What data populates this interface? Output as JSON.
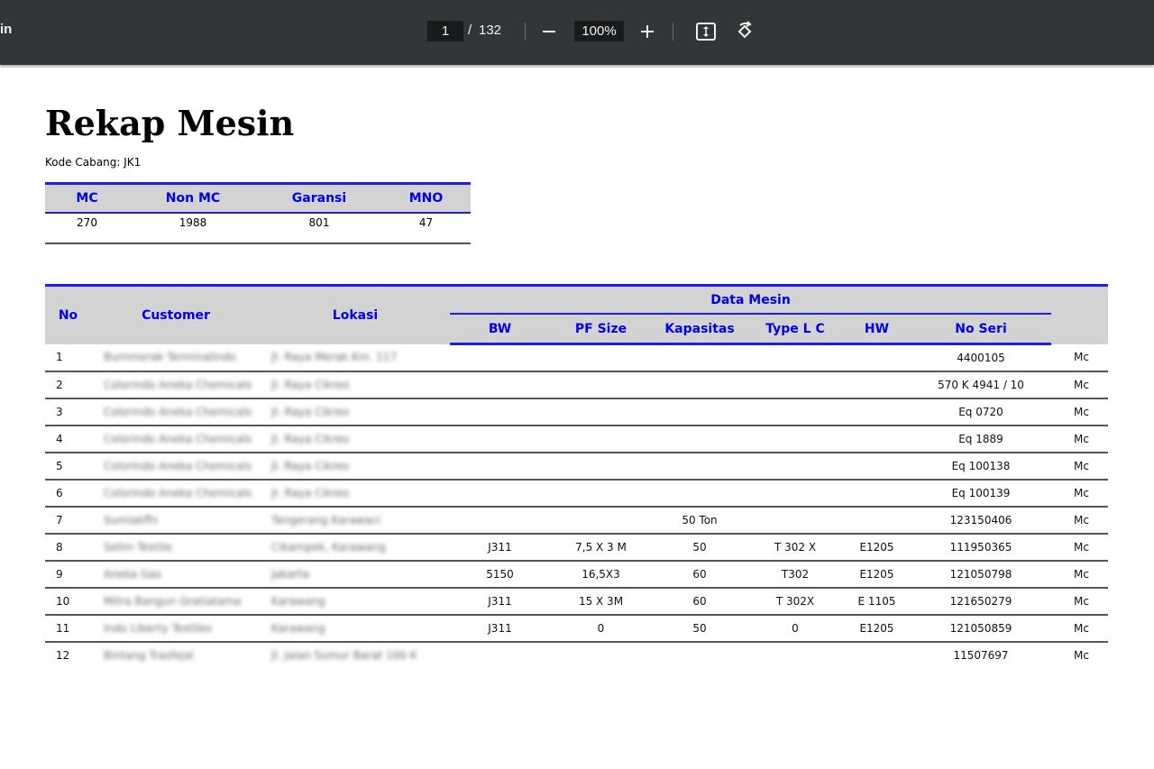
{
  "viewer": {
    "title": "in",
    "page_current": "1",
    "page_separator": "/",
    "page_total": "132",
    "zoom": "100%",
    "icons": [
      "zoom-out-icon",
      "zoom-in-icon",
      "fit-page-icon",
      "rotate-icon"
    ]
  },
  "document": {
    "title": "Rekap Mesin",
    "branch_label": "Kode Cabang: JK1"
  },
  "summary": {
    "headers": [
      "MC",
      "Non MC",
      "Garansi",
      "MNO"
    ],
    "values": [
      "270",
      "1988",
      "801",
      "47"
    ]
  },
  "machines": {
    "headers": {
      "no": "No",
      "customer": "Customer",
      "lokasi": "Lokasi",
      "group": "Data Mesin",
      "bw": "BW",
      "pf_size": "PF Size",
      "kapasitas": "Kapasitas",
      "type_lc": "Type L C",
      "hw": "HW",
      "no_seri": "No Seri"
    },
    "rows": [
      {
        "no": "1",
        "customer": "Burnmerak Terminalindo",
        "lokasi": "Jl. Raya Merak Km. 117",
        "bw": "",
        "pf_size": "",
        "kapasitas": "",
        "type_lc": "",
        "hw": "",
        "no_seri": "4400105",
        "type": "Mc"
      },
      {
        "no": "2",
        "customer": "Colorindo Aneka Chemicals",
        "lokasi": "Jl. Raya Cikreo",
        "bw": "",
        "pf_size": "",
        "kapasitas": "",
        "type_lc": "",
        "hw": "",
        "no_seri": "570 K 4941 / 10",
        "type": "Mc"
      },
      {
        "no": "3",
        "customer": "Colorindo Aneka Chemicals",
        "lokasi": "Jl. Raya Cikreo",
        "bw": "",
        "pf_size": "",
        "kapasitas": "",
        "type_lc": "",
        "hw": "",
        "no_seri": "Eq 0720",
        "type": "Mc"
      },
      {
        "no": "4",
        "customer": "Colorindo Aneka Chemicals",
        "lokasi": "Jl. Raya Cikreo",
        "bw": "",
        "pf_size": "",
        "kapasitas": "",
        "type_lc": "",
        "hw": "",
        "no_seri": "Eq 1889",
        "type": "Mc"
      },
      {
        "no": "5",
        "customer": "Colorindo Aneka Chemicals",
        "lokasi": "Jl. Raya Cikreo",
        "bw": "",
        "pf_size": "",
        "kapasitas": "",
        "type_lc": "",
        "hw": "",
        "no_seri": "Eq 100138",
        "type": "Mc"
      },
      {
        "no": "6",
        "customer": "Colorindo Aneka Chemicals",
        "lokasi": "Jl. Raya Cikreo",
        "bw": "",
        "pf_size": "",
        "kapasitas": "",
        "type_lc": "",
        "hw": "",
        "no_seri": "Eq 100139",
        "type": "Mc"
      },
      {
        "no": "7",
        "customer": "Sumiakffn",
        "lokasi": "Tangerang Karawaci",
        "bw": "",
        "pf_size": "",
        "kapasitas": "50 Ton",
        "type_lc": "",
        "hw": "",
        "no_seri": "123150406",
        "type": "Mc"
      },
      {
        "no": "8",
        "customer": "Selim Textile",
        "lokasi": "Cikampek, Karawang",
        "bw": "J311",
        "pf_size": "7,5 X 3 M",
        "kapasitas": "50",
        "type_lc": "T 302 X",
        "hw": "E1205",
        "no_seri": "111950365",
        "type": "Mc"
      },
      {
        "no": "9",
        "customer": "Aneka Gas",
        "lokasi": "Jakarta",
        "bw": "5150",
        "pf_size": "16,5X3",
        "kapasitas": "60",
        "type_lc": "T302",
        "hw": "E1205",
        "no_seri": "121050798",
        "type": "Mc"
      },
      {
        "no": "10",
        "customer": "Mitra Bangun Gratiatama",
        "lokasi": "Karawang",
        "bw": "J311",
        "pf_size": "15 X 3M",
        "kapasitas": "60",
        "type_lc": "T 302X",
        "hw": "E 1105",
        "no_seri": "121650279",
        "type": "Mc"
      },
      {
        "no": "11",
        "customer": "Indo Liberty Textiles",
        "lokasi": "Karawang",
        "bw": "J311",
        "pf_size": "0",
        "kapasitas": "50",
        "type_lc": "0",
        "hw": "E1205",
        "no_seri": "121050859",
        "type": "Mc"
      },
      {
        "no": "12",
        "customer": "Bintang Trasfejal",
        "lokasi": "Jl. Jalan Sumur Barat 100 K",
        "bw": "",
        "pf_size": "",
        "kapasitas": "",
        "type_lc": "",
        "hw": "",
        "no_seri": "11507697",
        "type": "Mc"
      }
    ]
  }
}
